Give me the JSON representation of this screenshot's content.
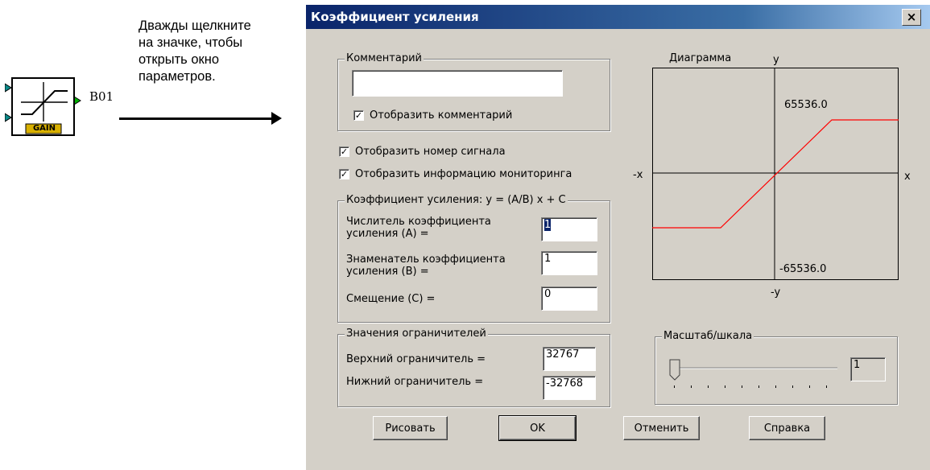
{
  "instruction": {
    "lines": [
      "Дважды щелкните",
      "на значке, чтобы",
      "открыть окно",
      "параметров."
    ]
  },
  "block": {
    "label": "B01",
    "icon_text": "GAIN"
  },
  "dialog": {
    "title": "Коэффициент усиления",
    "close_label": "×",
    "comment_group": {
      "title": "Комментарий",
      "value": "",
      "show_comment_label": "Отобразить комментарий",
      "show_comment_checked": true
    },
    "show_signal_number_label": "Отобразить номер сигнала",
    "show_signal_number_checked": true,
    "show_monitoring_label": "Отобразить информацию мониторинга",
    "show_monitoring_checked": true,
    "gain_group": {
      "title": "Коэффициент усиления:  y = (A/B) x + C",
      "numerator_label_1": "Числитель коэффициента",
      "numerator_label_2": "усиления (A) =",
      "numerator_value": "1",
      "denominator_label_1": "Знаменатель коэффициента",
      "denominator_label_2": "усиления (B) =",
      "denominator_value": "1",
      "offset_label": "Смещение (C) =",
      "offset_value": "0"
    },
    "limiter_group": {
      "title": "Значения ограничителей",
      "upper_label": "Верхний ограничитель =",
      "upper_value": "32767",
      "lower_label": "Нижний ограничитель =",
      "lower_value": "-32768"
    },
    "diagram": {
      "title": "Диаграмма",
      "y_label": "y",
      "neg_y_label": "-y",
      "x_label": "x",
      "neg_x_label": "-x",
      "y_max": "65536.0",
      "y_min": "-65536.0",
      "line_color": "#ff0000"
    },
    "scale_group": {
      "title": "Масштаб/шкала",
      "value": "1"
    },
    "buttons": {
      "draw": "Рисовать",
      "ok": "OK",
      "cancel": "Отменить",
      "help": "Справка"
    }
  }
}
